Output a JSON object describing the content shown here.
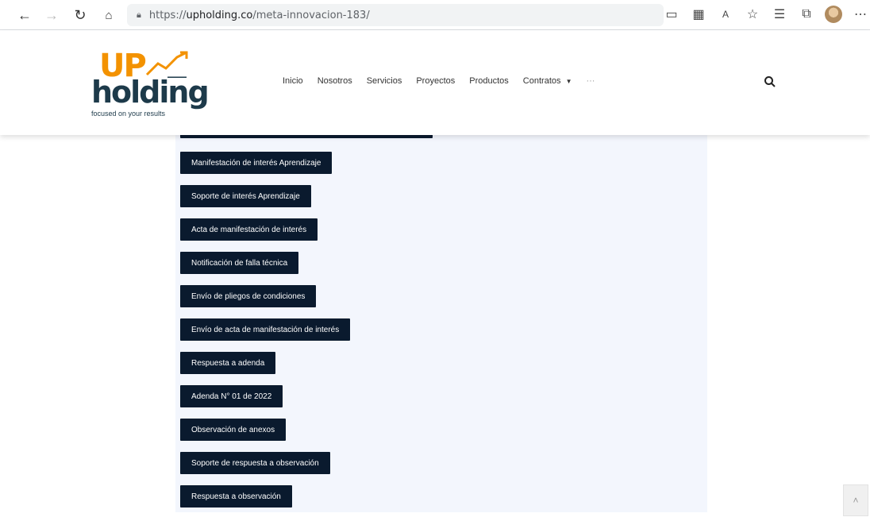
{
  "browser": {
    "url_prefix": "https://",
    "url_host": "upholding.co",
    "url_path": "/meta-innovacion-183/"
  },
  "logo": {
    "part1": "UP",
    "part2": "holding",
    "tagline": "focused on your results"
  },
  "nav": {
    "items": [
      "Inicio",
      "Nosotros",
      "Servicios",
      "Proyectos",
      "Productos",
      "Contratos"
    ],
    "more": "···"
  },
  "documents": [
    "Manifestación de interés Aprendizaje",
    "Soporte de interés Aprendizaje",
    "Acta de manifestación de interés",
    "Notificación de falla técnica",
    "Envío de pliegos de condiciones",
    "Envío de acta de manifestación de interés",
    "Respuesta a adenda",
    "Adenda N° 01 de 2022",
    "Observación de anexos",
    "Soporte de respuesta a observación",
    "Respuesta a observación"
  ],
  "colors": {
    "brand_orange": "#f39200",
    "brand_dark": "#1d3a4a",
    "button_bg": "#0a1a2e",
    "content_bg": "#f3f6fd"
  }
}
